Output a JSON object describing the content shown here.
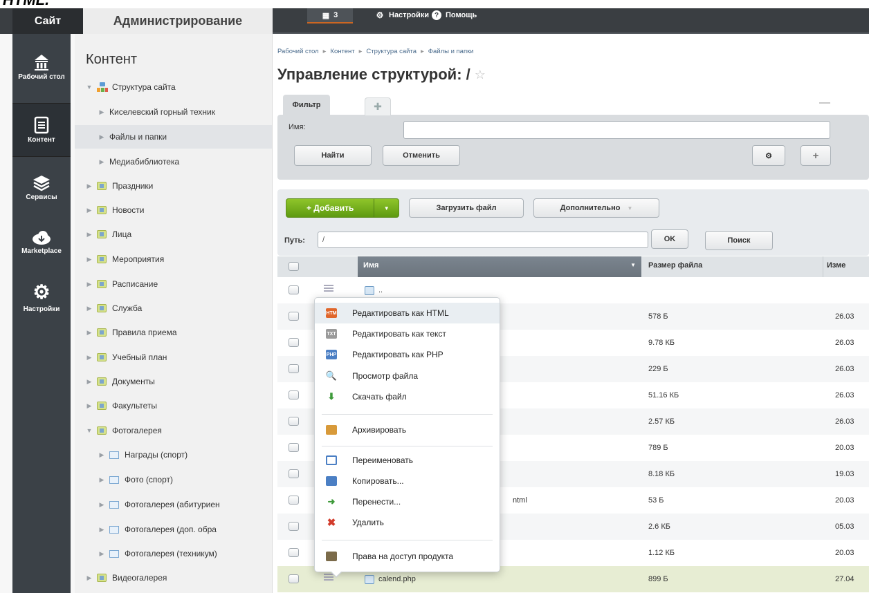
{
  "caption_fragment": "HTML.",
  "topbar": {
    "site": "Сайт",
    "admin": "Администрирование",
    "notifications_count": "3",
    "settings": "Настройки",
    "help": "Помощь"
  },
  "rail": [
    {
      "label": "Рабочий стол",
      "icon": "home-icon"
    },
    {
      "label": "Контент",
      "icon": "document-icon",
      "active": true
    },
    {
      "label": "Сервисы",
      "icon": "layers-icon"
    },
    {
      "label": "Marketplace",
      "icon": "cloud-icon"
    },
    {
      "label": "Настройки",
      "icon": "gear-icon"
    }
  ],
  "sidebar": {
    "title": "Контент",
    "items": [
      {
        "label": "Структура сайта",
        "expanded": true
      },
      {
        "label": "Киселевский горный техник"
      },
      {
        "label": "Файлы и папки",
        "selected": true
      },
      {
        "label": "Медиабиблиотека"
      },
      {
        "label": "Праздники"
      },
      {
        "label": "Новости"
      },
      {
        "label": "Лица"
      },
      {
        "label": "Мероприятия"
      },
      {
        "label": "Расписание"
      },
      {
        "label": "Служба"
      },
      {
        "label": "Правила приема"
      },
      {
        "label": "Учебный план"
      },
      {
        "label": "Документы"
      },
      {
        "label": "Факультеты"
      },
      {
        "label": "Фотогалерея",
        "expanded": true
      },
      {
        "label": "Награды (спорт)"
      },
      {
        "label": "Фото (спорт)"
      },
      {
        "label": "Фотогалерея (абитуриен"
      },
      {
        "label": "Фотогалерея (доп. обра"
      },
      {
        "label": "Фотогалерея (техникум)"
      },
      {
        "label": "Видеогалерея"
      }
    ]
  },
  "breadcrumb": [
    "Рабочий стол",
    "Контент",
    "Структура сайта",
    "Файлы и папки"
  ],
  "page_title": "Управление структурой: /",
  "filter": {
    "tab_label": "Фильтр",
    "name_label": "Имя:",
    "name_value": "",
    "find_button": "Найти",
    "cancel_button": "Отменить"
  },
  "toolbar": {
    "add_button": "+ Добавить",
    "upload_button": "Загрузить файл",
    "more_button": "Дополнительно",
    "path_label": "Путь:",
    "path_value": "/",
    "ok_button": "OK",
    "search_button": "Поиск"
  },
  "table": {
    "columns": {
      "name": "Имя",
      "size": "Размер файла",
      "modified": "Изме"
    },
    "rows": [
      {
        "name": "..",
        "size": "",
        "date": ""
      },
      {
        "name": "",
        "size": "578 Б",
        "date": "26.03"
      },
      {
        "name": "",
        "size": "9.78 КБ",
        "date": "26.03"
      },
      {
        "name": "",
        "size": "229 Б",
        "date": "26.03"
      },
      {
        "name": "",
        "size": "51.16 КБ",
        "date": "26.03"
      },
      {
        "name": "",
        "size": "2.57 КБ",
        "date": "26.03"
      },
      {
        "name": "",
        "size": "789 Б",
        "date": "20.03"
      },
      {
        "name": "",
        "size": "8.18 КБ",
        "date": "19.03"
      },
      {
        "name": "ntml",
        "size": "53 Б",
        "date": "20.03"
      },
      {
        "name": "",
        "size": "2.6 КБ",
        "date": "05.03"
      },
      {
        "name": "",
        "size": "1.12 КБ",
        "date": "20.03"
      },
      {
        "name": "calend.php",
        "size": "899 Б",
        "date": "27.04"
      }
    ]
  },
  "context_menu": {
    "items": [
      {
        "label": "Редактировать как HTML",
        "icon": "html-file-icon",
        "color": "#e0662b"
      },
      {
        "label": "Редактировать как текст",
        "icon": "txt-file-icon",
        "color": "#9a9a9a"
      },
      {
        "label": "Редактировать как PHP",
        "icon": "php-file-icon",
        "color": "#4b7fc4"
      },
      {
        "label": "Просмотр файла",
        "icon": "view-file-icon",
        "color": "#4b7fc4"
      },
      {
        "label": "Скачать файл",
        "icon": "download-icon",
        "color": "#3e9a3a"
      },
      {
        "label": "Архивировать",
        "icon": "archive-icon",
        "color": "#d89a3a"
      },
      {
        "label": "Переименовать",
        "icon": "rename-icon",
        "color": "#4b7fc4"
      },
      {
        "label": "Копировать...",
        "icon": "copy-icon",
        "color": "#4b7fc4"
      },
      {
        "label": "Перенести...",
        "icon": "move-icon",
        "color": "#3e9a3a"
      },
      {
        "label": "Удалить",
        "icon": "delete-icon",
        "color": "#d23b2b"
      },
      {
        "label": "Права на доступ продукта",
        "icon": "access-rights-icon",
        "color": "#7b6b4a"
      }
    ]
  }
}
